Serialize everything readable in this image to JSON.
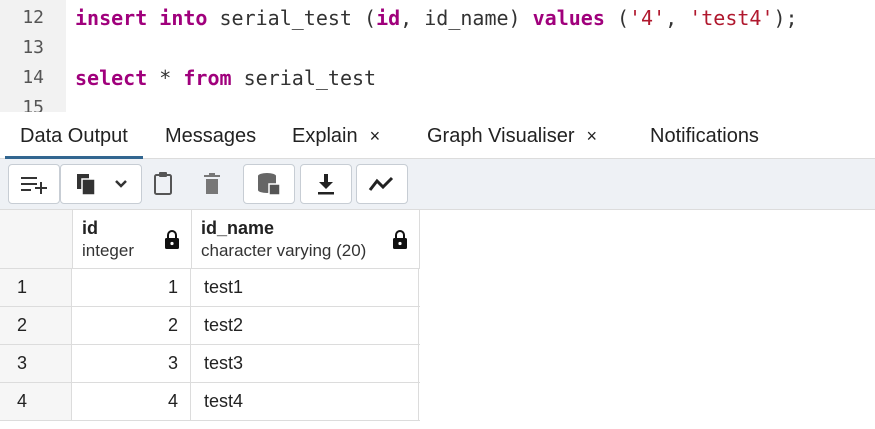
{
  "editor": {
    "lines": [
      {
        "number": "12",
        "insert_kw": "insert",
        "into_kw": "into",
        "table": "serial_test",
        "cols_open": "(",
        "col1": "id",
        "comma1": ",",
        "col2": "id_name",
        "cols_close": ")",
        "values_kw": "values",
        "vals_open": "(",
        "val1": "'4'",
        "comma2": ",",
        "val2": "'test4'",
        "end": ");"
      },
      {
        "number": "13"
      },
      {
        "number": "14",
        "select_kw": "select",
        "star": "*",
        "from_kw": "from",
        "table": "serial_test"
      },
      {
        "number": "15"
      }
    ]
  },
  "tabs": [
    {
      "label": "Data Output",
      "active": true
    },
    {
      "label": "Messages"
    },
    {
      "label": "Explain",
      "close": "×"
    },
    {
      "label": "Graph Visualiser",
      "close": "×"
    },
    {
      "label": "Notifications"
    }
  ],
  "toolbar": {
    "buttons": [
      "add-row-icon",
      "copy-icon",
      "chevron-down-icon",
      "paste-icon",
      "delete-icon",
      "save-data-icon",
      "download-icon",
      "graph-icon"
    ]
  },
  "grid": {
    "columns": [
      {
        "name": "id",
        "type": "integer",
        "icon": "lock-icon"
      },
      {
        "name": "id_name",
        "type": "character varying (20)",
        "icon": "lock-icon"
      }
    ],
    "rows": [
      {
        "num": "1",
        "id": "1",
        "id_name": "test1"
      },
      {
        "num": "2",
        "id": "2",
        "id_name": "test2"
      },
      {
        "num": "3",
        "id": "3",
        "id_name": "test3"
      },
      {
        "num": "4",
        "id": "4",
        "id_name": "test4"
      }
    ]
  }
}
